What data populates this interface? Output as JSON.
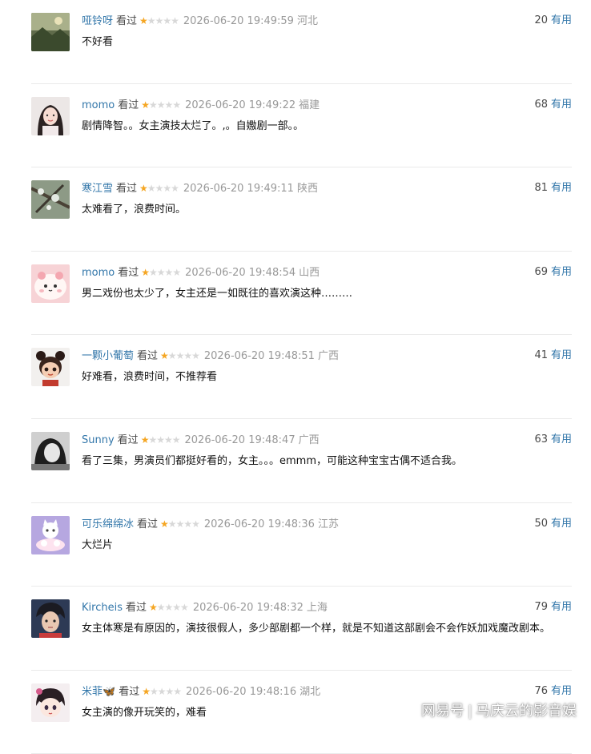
{
  "comments": [
    {
      "user": "哑铃呀",
      "status": "看过",
      "rating": 1,
      "time": "2026-06-20 19:49:59",
      "region": "河北",
      "votes": "20",
      "useful": "有用",
      "text": "不好看",
      "avatar_icon": "landscape-avatar-icon"
    },
    {
      "user": "momo",
      "status": "看过",
      "rating": 1,
      "time": "2026-06-20 19:49:22",
      "region": "福建",
      "votes": "68",
      "useful": "有用",
      "text": "剧情降智。。女主演技太烂了。,。自嫐剧一部。。",
      "avatar_icon": "girl-portrait-avatar-icon"
    },
    {
      "user": "寒江雪",
      "status": "看过",
      "rating": 1,
      "time": "2026-06-20 19:49:11",
      "region": "陕西",
      "votes": "81",
      "useful": "有用",
      "text": "太难看了，浪费时间。",
      "avatar_icon": "snowy-branch-avatar-icon"
    },
    {
      "user": "momo",
      "status": "看过",
      "rating": 1,
      "time": "2026-06-20 19:48:54",
      "region": "山西",
      "votes": "69",
      "useful": "有用",
      "text": "男二戏份也太少了，女主还是一如既往的喜欢演这种………",
      "avatar_icon": "pink-bun-avatar-icon"
    },
    {
      "user": "一颗小葡萄",
      "status": "看过",
      "rating": 1,
      "time": "2026-06-20 19:48:51",
      "region": "广西",
      "votes": "41",
      "useful": "有用",
      "text": "好难看，浪费时间，不推荐看",
      "avatar_icon": "cartoon-girl-avatar-icon"
    },
    {
      "user": "Sunny",
      "status": "看过",
      "rating": 1,
      "time": "2026-06-20 19:48:47",
      "region": "广西",
      "votes": "63",
      "useful": "有用",
      "text": "看了三集，男演员们都挺好看的，女主。。。emmm，可能这种宝宝古偶不适合我。",
      "avatar_icon": "bw-portrait-avatar-icon"
    },
    {
      "user": "可乐绵绵冰",
      "status": "看过",
      "rating": 1,
      "time": "2026-06-20 19:48:36",
      "region": "江苏",
      "votes": "50",
      "useful": "有用",
      "text": "大烂片",
      "avatar_icon": "cartoon-cats-avatar-icon"
    },
    {
      "user": "Kircheis",
      "status": "看过",
      "rating": 1,
      "time": "2026-06-20 19:48:32",
      "region": "上海",
      "votes": "79",
      "useful": "有用",
      "text": "女主体寒是有原因的，演技很假人，多少部剧都一个样，就是不知道这部剧会不会作妖加戏魔改剧本。",
      "avatar_icon": "anime-boy-avatar-icon"
    },
    {
      "user": "米菲🦋",
      "status": "看过",
      "rating": 1,
      "time": "2026-06-20 19:48:16",
      "region": "湖北",
      "votes": "76",
      "useful": "有用",
      "text": "女主演的像开玩笑的，难看",
      "avatar_icon": "chibi-avatar-icon"
    }
  ],
  "watermark": {
    "brand": "网易号",
    "account": "马庆云的影音娱"
  },
  "colors": {
    "username": "#3377aa",
    "star_on": "#f5a623",
    "star_off": "#d8d8d8",
    "meta": "#999999",
    "divider": "#eaeaea"
  }
}
